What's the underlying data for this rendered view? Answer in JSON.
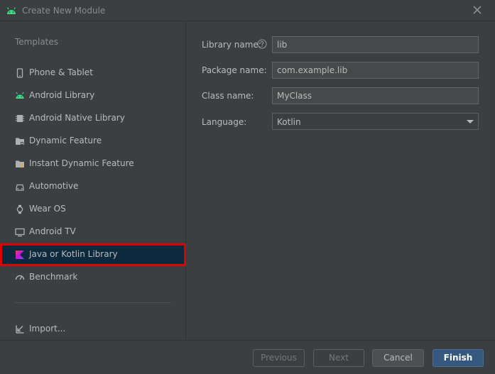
{
  "window": {
    "title": "Create New Module",
    "close_icon": "close-icon"
  },
  "sidebar": {
    "heading": "Templates",
    "items": [
      {
        "label": "Phone & Tablet",
        "icon": "phone-icon"
      },
      {
        "label": "Android Library",
        "icon": "android-icon"
      },
      {
        "label": "Android Native Library",
        "icon": "chip-icon"
      },
      {
        "label": "Dynamic Feature",
        "icon": "folder-icon"
      },
      {
        "label": "Instant Dynamic Feature",
        "icon": "folder-lightning-icon"
      },
      {
        "label": "Automotive",
        "icon": "car-icon"
      },
      {
        "label": "Wear OS",
        "icon": "watch-icon"
      },
      {
        "label": "Android TV",
        "icon": "tv-icon"
      },
      {
        "label": "Java or Kotlin Library",
        "icon": "kotlin-icon",
        "selected": true
      },
      {
        "label": "Benchmark",
        "icon": "gauge-icon"
      }
    ],
    "import_label": "Import...",
    "selection_highlight_color": "#e00000"
  },
  "form": {
    "library_name": {
      "label": "Library name:",
      "value": "lib"
    },
    "package_name": {
      "label": "Package name:",
      "value": "com.example.lib"
    },
    "class_name": {
      "label": "Class name:",
      "value": "MyClass"
    },
    "language": {
      "label": "Language:",
      "value": "Kotlin"
    }
  },
  "footer": {
    "previous_label": "Previous",
    "next_label": "Next",
    "cancel_label": "Cancel",
    "finish_label": "Finish"
  },
  "colors": {
    "background": "#3c3f41",
    "selected_bg": "#0d293e",
    "primary_button": "#365880",
    "android_green": "#3ddc84"
  }
}
